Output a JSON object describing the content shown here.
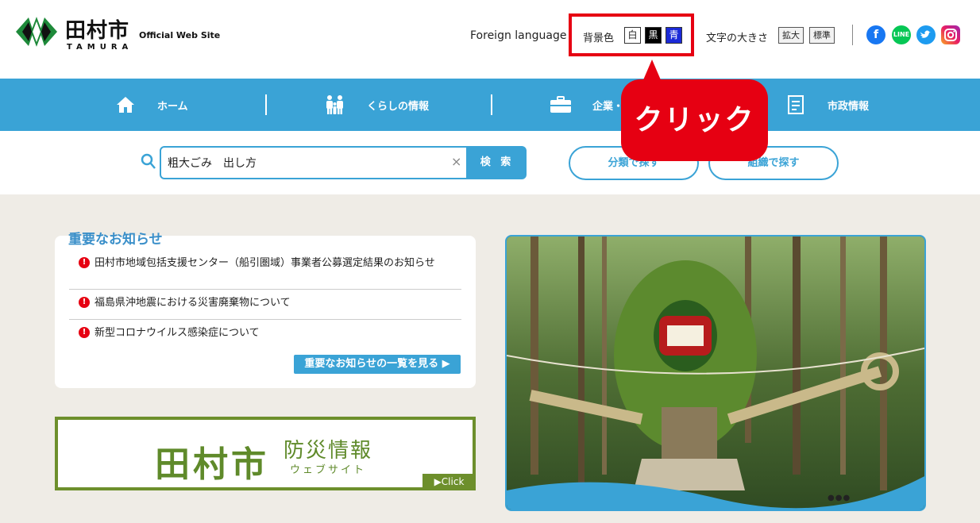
{
  "header": {
    "logo_jp": "田村市",
    "logo_en": "TAMURA",
    "logo_sub": "Official Web Site",
    "foreign_language": "Foreign language",
    "bg_color_label": "背景色",
    "bg_white": "白",
    "bg_black": "黒",
    "bg_blue": "青",
    "font_size_label": "文字の大きさ",
    "font_large": "拡大",
    "font_standard": "標準",
    "sns": [
      "facebook-icon",
      "line-icon",
      "twitter-icon",
      "instagram-icon"
    ]
  },
  "nav": {
    "items": [
      {
        "label": "ホーム",
        "icon": "home-icon"
      },
      {
        "label": "くらしの情報",
        "icon": "family-icon"
      },
      {
        "label": "企業・",
        "icon": "briefcase-icon"
      },
      {
        "label": "市政情報",
        "icon": "document-icon"
      }
    ]
  },
  "search": {
    "value": "粗大ごみ　出し方",
    "clear": "×",
    "button": "検 索",
    "by_category": "分類で探す",
    "by_organization": "組織で探す"
  },
  "callout": {
    "text": "クリック"
  },
  "notices": {
    "title": "重要なお知らせ",
    "items": [
      "田村市地域包括支援センター（船引圏域）事業者公募選定結果のお知らせ",
      "福島県沖地震における災害廃棄物について",
      "新型コロナウイルス感染症について"
    ],
    "more": "重要なお知らせの一覧を見る ▶"
  },
  "disaster_banner": {
    "main": "田村市",
    "sub": "防災情報",
    "web": "ウェブサイト",
    "click": "▶Click"
  },
  "hero": {
    "dots": "●●●"
  },
  "colors": {
    "accent": "#3aa3d6",
    "highlight": "#e60012",
    "green": "#6d8f2c"
  }
}
